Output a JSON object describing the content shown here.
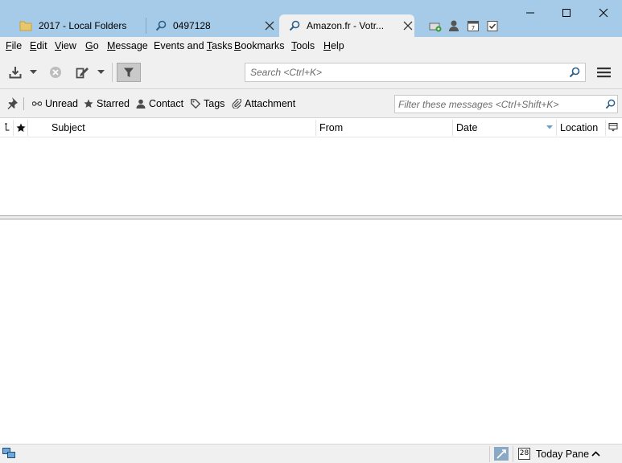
{
  "tabs": [
    {
      "label": "2017 - Local Folders",
      "icon": "folder-icon"
    },
    {
      "label": "0497128",
      "icon": "search-icon"
    },
    {
      "label": "Amazon.fr - Votr...",
      "icon": "search-icon",
      "active": true
    }
  ],
  "menu": [
    {
      "label": "File",
      "accel": "F",
      "rest": "ile"
    },
    {
      "label": "Edit",
      "accel": "E",
      "rest": "dit"
    },
    {
      "label": "View",
      "accel": "V",
      "rest": "iew"
    },
    {
      "label": "Go",
      "accel": "G",
      "rest": "o"
    },
    {
      "label": "Message",
      "accel": "M",
      "rest": "essage"
    },
    {
      "label": "Events and Tasks",
      "pre": "Events and ",
      "accel": "T",
      "rest": "asks"
    },
    {
      "label": "Bookmarks",
      "accel": "B",
      "rest": "ookmarks"
    },
    {
      "label": "Tools",
      "accel": "T",
      "rest": "ools"
    },
    {
      "label": "Help",
      "accel": "H",
      "rest": "elp"
    }
  ],
  "toolbar": {
    "search_placeholder": "Search <Ctrl+K>"
  },
  "quickfilter": {
    "unread": "Unread",
    "starred": "Starred",
    "contact": "Contact",
    "tags": "Tags",
    "attachment": "Attachment",
    "filter_placeholder": "Filter these messages <Ctrl+Shift+K>"
  },
  "columns": {
    "subject": "Subject",
    "from": "From",
    "date": "Date",
    "location": "Location"
  },
  "statusbar": {
    "calendar_day": "28",
    "today_pane": "Today Pane"
  },
  "colors": {
    "titlebar": "#a5cbe8",
    "chrome": "#f0f0f0",
    "icon": "#4a4a4a"
  }
}
